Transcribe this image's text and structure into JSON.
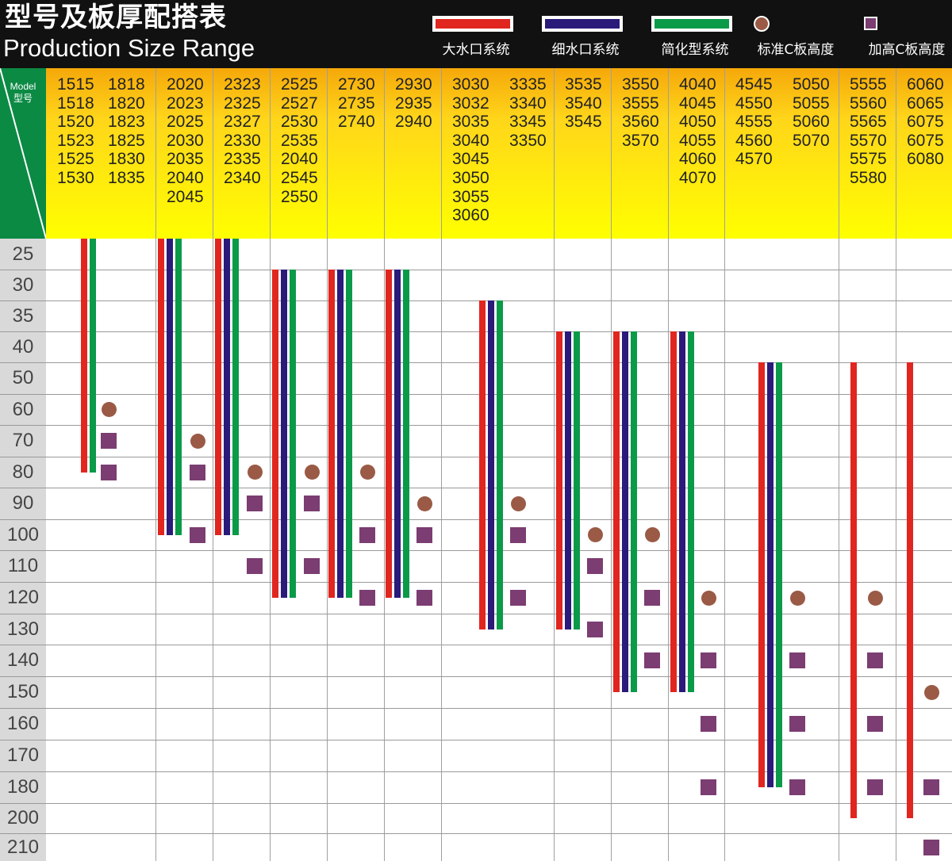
{
  "title": {
    "cn": "型号及板厚配搭表",
    "en": "Production Size Range"
  },
  "legend": {
    "big_gate": {
      "label": "大水口系统",
      "color": "#e0261f"
    },
    "fine_gate": {
      "label": "细水口系统",
      "color": "#2a1a7a"
    },
    "simplified": {
      "label": "简化型系统",
      "color": "#0a9a48"
    },
    "standard_c": {
      "label": "标准C板高度",
      "icon": "circle-icon",
      "color": "#9a5a45"
    },
    "raised_c": {
      "label": "加高C板高度",
      "icon": "square-icon",
      "color": "#7b3d72"
    }
  },
  "corner": {
    "model_en": "Model",
    "model_cn": "型号"
  },
  "thickness_values": [
    25,
    30,
    35,
    40,
    50,
    60,
    70,
    80,
    90,
    100,
    110,
    120,
    130,
    140,
    150,
    160,
    170,
    180,
    200,
    210
  ],
  "models": [
    {
      "col1": [
        "1515",
        "1518",
        "1520",
        "1523",
        "1525",
        "1530"
      ],
      "col2": [
        "1818",
        "1820",
        "1823",
        "1825",
        "1830",
        "1835"
      ]
    },
    {
      "col1": [
        "2020",
        "2023",
        "2025",
        "2030",
        "2035",
        "2040",
        "2045"
      ]
    },
    {
      "col1": [
        "2323",
        "2325",
        "2327",
        "2330",
        "2335",
        "2340"
      ]
    },
    {
      "col1": [
        "2525",
        "2527",
        "2530",
        "2535",
        "2040",
        "2545",
        "2550"
      ]
    },
    {
      "col1": [
        "2730",
        "2735",
        "2740"
      ]
    },
    {
      "col1": [
        "2930",
        "2935",
        "2940"
      ]
    },
    {
      "col1": [
        "3030",
        "3032",
        "3035",
        "3040",
        "3045",
        "3050",
        "3055",
        "3060"
      ],
      "col2": [
        "3335",
        "3340",
        "3345",
        "3350"
      ]
    },
    {
      "col1": [
        "3535",
        "3540",
        "3545"
      ]
    },
    {
      "col1": [
        "3550",
        "3555",
        "3560",
        "3570"
      ]
    },
    {
      "col1": [
        "4040",
        "4045",
        "4050",
        "4055",
        "4060",
        "4070"
      ]
    },
    {
      "col1": [
        "4545",
        "4550",
        "4555",
        "4560",
        "4570"
      ],
      "col2": [
        "5050",
        "5055",
        "5060",
        "5070"
      ]
    },
    {
      "col1": [
        "5555",
        "5560",
        "5565",
        "5570",
        "5575",
        "5580"
      ]
    },
    {
      "col1": [
        "6060",
        "6065",
        "6075",
        "6075",
        "6080"
      ]
    }
  ],
  "ranges": [
    {
      "systems": [
        "big_gate",
        "simplified"
      ],
      "from": 25,
      "to": 80,
      "standard_c": [
        60
      ],
      "raised_c": [
        70,
        80
      ]
    },
    {
      "systems": [
        "big_gate",
        "fine_gate",
        "simplified"
      ],
      "from": 25,
      "to": 100,
      "standard_c": [
        70
      ],
      "raised_c": [
        80,
        100
      ]
    },
    {
      "systems": [
        "big_gate",
        "fine_gate",
        "simplified"
      ],
      "from": 25,
      "to": 100,
      "standard_c": [
        80
      ],
      "raised_c": [
        90,
        110
      ]
    },
    {
      "systems": [
        "big_gate",
        "fine_gate",
        "simplified"
      ],
      "from": 30,
      "to": 120,
      "standard_c": [
        80
      ],
      "raised_c": [
        90,
        110
      ]
    },
    {
      "systems": [
        "big_gate",
        "fine_gate",
        "simplified"
      ],
      "from": 30,
      "to": 120,
      "standard_c": [
        80
      ],
      "raised_c": [
        100,
        120
      ]
    },
    {
      "systems": [
        "big_gate",
        "fine_gate",
        "simplified"
      ],
      "from": 30,
      "to": 120,
      "standard_c": [
        90
      ],
      "raised_c": [
        100,
        120
      ]
    },
    {
      "systems": [
        "big_gate",
        "fine_gate",
        "simplified"
      ],
      "from": 35,
      "to": 130,
      "standard_c": [
        90
      ],
      "raised_c": [
        100,
        120
      ]
    },
    {
      "systems": [
        "big_gate",
        "fine_gate",
        "simplified"
      ],
      "from": 40,
      "to": 130,
      "standard_c": [
        100
      ],
      "raised_c": [
        110,
        130
      ]
    },
    {
      "systems": [
        "big_gate",
        "fine_gate",
        "simplified"
      ],
      "from": 40,
      "to": 150,
      "standard_c": [
        100
      ],
      "raised_c": [
        120,
        140
      ]
    },
    {
      "systems": [
        "big_gate",
        "fine_gate",
        "simplified"
      ],
      "from": 40,
      "to": 150,
      "standard_c": [
        120
      ],
      "raised_c": [
        140,
        160,
        180
      ]
    },
    {
      "systems": [
        "big_gate",
        "fine_gate",
        "simplified"
      ],
      "from": 50,
      "to": 180,
      "standard_c": [
        120
      ],
      "raised_c": [
        140,
        160,
        180
      ]
    },
    {
      "systems": [
        "big_gate"
      ],
      "from": 50,
      "to": 200,
      "standard_c": [
        120
      ],
      "raised_c": [
        140,
        160,
        180
      ]
    },
    {
      "systems": [
        "big_gate"
      ],
      "from": 50,
      "to": 200,
      "standard_c": [
        150
      ],
      "raised_c": [
        180,
        210
      ]
    }
  ]
}
